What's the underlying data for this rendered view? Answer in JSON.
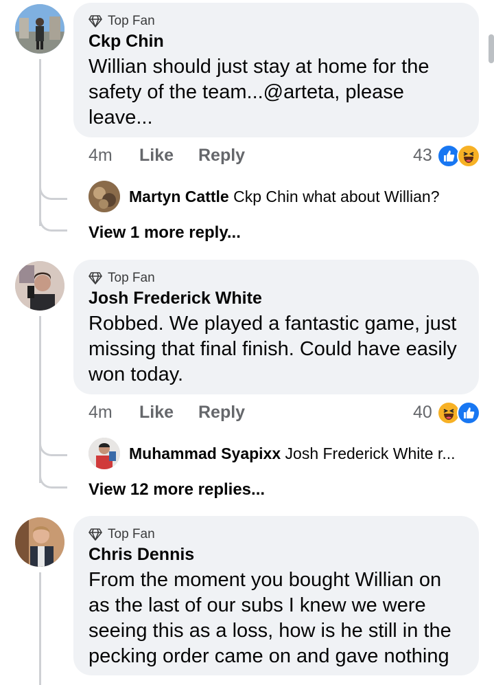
{
  "comments": [
    {
      "badge": "Top Fan",
      "author": "Ckp Chin",
      "lines": [
        "Willian should just stay at home for the",
        "safety of the team...@arteta, please",
        "leave..."
      ],
      "time": "4m",
      "like_label": "Like",
      "reply_label": "Reply",
      "reaction_count": "43",
      "reactions": [
        "like",
        "haha"
      ],
      "reply_preview": {
        "author": "Martyn Cattle",
        "text": "Ckp Chin what about Willian?"
      },
      "view_more": "View 1 more reply..."
    },
    {
      "badge": "Top Fan",
      "author": "Josh Frederick White",
      "lines": [
        "Robbed. We played a fantastic game, just",
        "missing that final finish. Could have easily",
        "won today."
      ],
      "time": "4m",
      "like_label": "Like",
      "reply_label": "Reply",
      "reaction_count": "40",
      "reactions": [
        "haha",
        "like"
      ],
      "reply_preview": {
        "author": "Muhammad Syapixx",
        "text": "Josh Frederick White r..."
      },
      "view_more": "View 12 more replies..."
    },
    {
      "badge": "Top Fan",
      "author": "Chris Dennis",
      "lines": [
        "From the moment you bought Willian on",
        "as the last of our subs I knew we were",
        "seeing this as a loss, how is he still in the",
        "pecking order came on and gave nothing"
      ]
    }
  ],
  "colors": {
    "like_blue": "#1877f2",
    "haha_yellow": "#f7b125",
    "bubble_bg": "#f0f2f5",
    "meta_gray": "#65676b"
  },
  "icons": [
    "diamond-icon",
    "like-reaction-icon",
    "haha-reaction-icon"
  ]
}
